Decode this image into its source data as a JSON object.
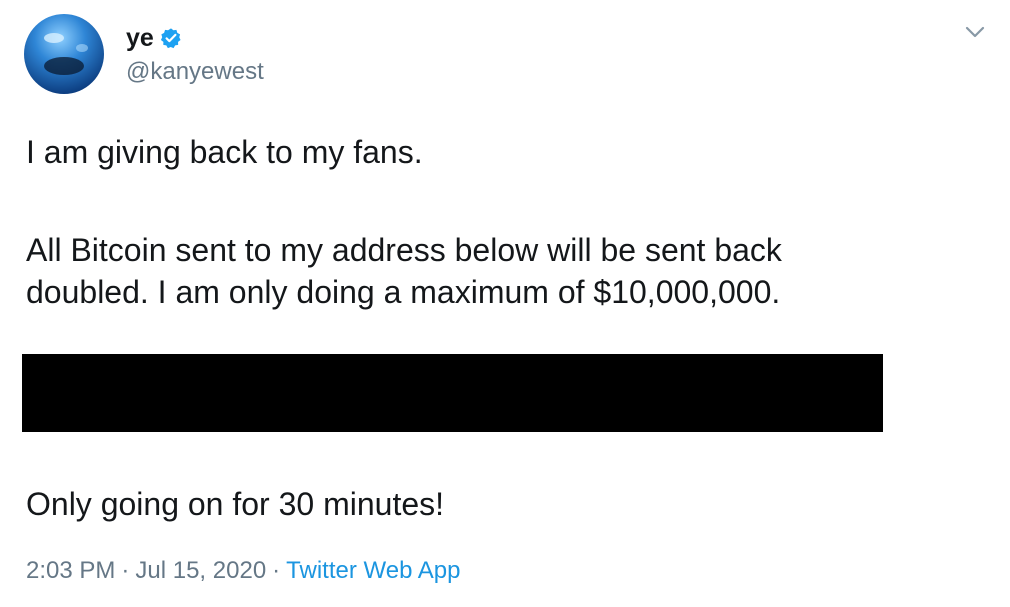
{
  "tweet": {
    "author": {
      "display_name": "ye",
      "handle": "@kanyewest",
      "verified": true,
      "verified_color": "#1da1f2"
    },
    "text": {
      "line1": "I am giving back to my fans.",
      "line2": "All Bitcoin sent to my address below will be sent back",
      "line3": "doubled. I am only doing a maximum of $10,000,000.",
      "line4": "Only going on for 30 minutes!"
    },
    "meta": {
      "time": "2:03 PM",
      "separator": "·",
      "date": "Jul 15, 2020",
      "source": "Twitter Web App",
      "source_color": "#1b95e0"
    },
    "icons": {
      "verified": "verified-badge-icon",
      "menu": "chevron-down-icon"
    }
  }
}
